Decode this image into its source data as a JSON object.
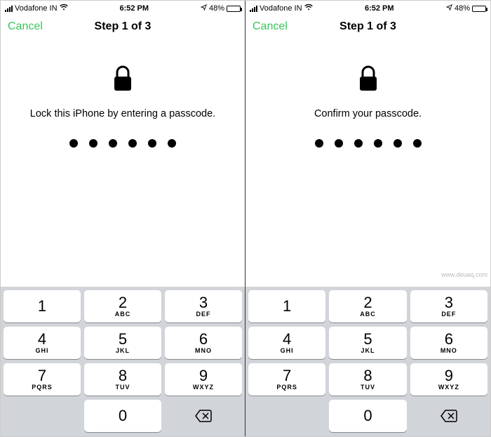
{
  "screens": [
    {
      "status": {
        "carrier": "Vodafone IN",
        "time": "6:52 PM",
        "battery": "48%"
      },
      "nav": {
        "cancel": "Cancel",
        "title": "Step 1 of 3"
      },
      "instruction": "Lock this iPhone by entering a passcode.",
      "passcode_length": 6
    },
    {
      "status": {
        "carrier": "Vodafone IN",
        "time": "6:52 PM",
        "battery": "48%"
      },
      "nav": {
        "cancel": "Cancel",
        "title": "Step 1 of 3"
      },
      "instruction": "Confirm your passcode.",
      "passcode_length": 6
    }
  ],
  "keypad": [
    [
      {
        "num": "1",
        "let": ""
      },
      {
        "num": "2",
        "let": "ABC"
      },
      {
        "num": "3",
        "let": "DEF"
      }
    ],
    [
      {
        "num": "4",
        "let": "GHI"
      },
      {
        "num": "5",
        "let": "JKL"
      },
      {
        "num": "6",
        "let": "MNO"
      }
    ],
    [
      {
        "num": "7",
        "let": "PQRS"
      },
      {
        "num": "8",
        "let": "TUV"
      },
      {
        "num": "9",
        "let": "WXYZ"
      }
    ]
  ],
  "zero": "0",
  "watermark": "www.deuaq.com"
}
